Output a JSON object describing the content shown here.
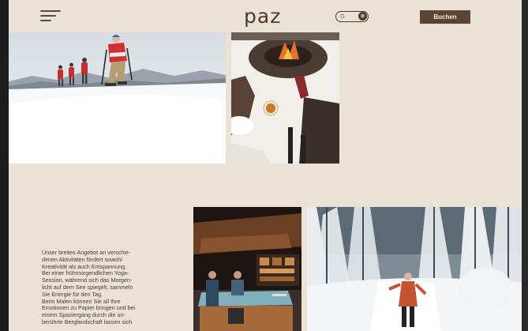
{
  "header": {
    "logo": "paz",
    "menu_icon": "hamburger-menu-icon",
    "theme_toggle": {
      "left_icon": "sun-icon",
      "right_icon": "snowflake-icon",
      "active": "winter"
    },
    "book_button_label": "Buchen"
  },
  "body_text": {
    "lines": [
      "Unser breites Angebot an verschie-",
      "denen Aktivitäten fördert sowohl",
      "Kreativität als auch Entspannung.",
      "Bei einer frühmorgendlichen Yoga-",
      "Session, während sich das Morgen-",
      "licht auf dem See spiegelt, sammeln",
      "Sie Energie für den Tag.",
      "Beim Malen können Sie all Ihre",
      "Emotionen zu Papier bringen und bei",
      "einem Spaziergang durch die un-",
      "berührte Berglandschaft lassen sich"
    ]
  },
  "colors": {
    "background": "#ebe2d6",
    "text": "#4a3a2c",
    "button": "#5a4434",
    "button_text": "#f1e9de"
  }
}
